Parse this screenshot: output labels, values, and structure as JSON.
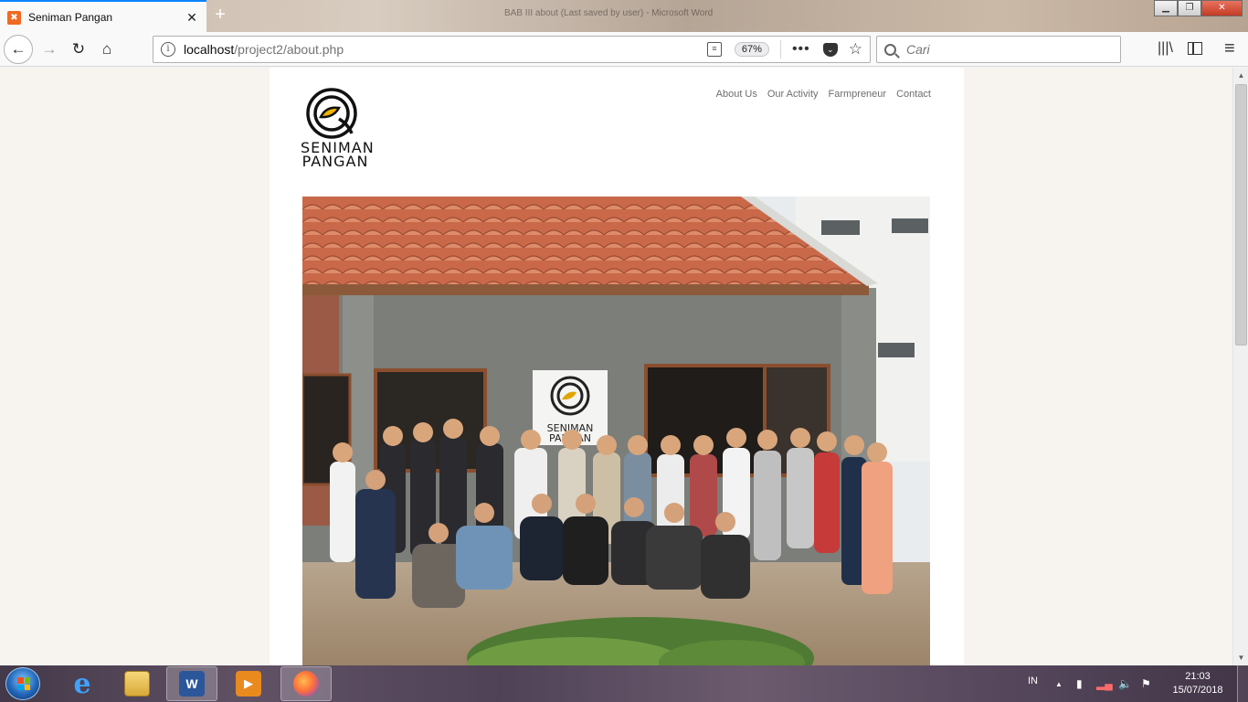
{
  "browser": {
    "tab": {
      "title": "Seniman Pangan",
      "favicon": "xampp-icon",
      "close": "✕"
    },
    "new_tab": "+",
    "window_title_blur": "BAB III about (Last saved by user) - Microsoft Word",
    "window_controls": {
      "minimize": "▁",
      "maximize": "❐",
      "close": "✕"
    },
    "nav": {
      "back": "←",
      "forward": "→",
      "reload": "↻",
      "home": "⌂"
    },
    "url": {
      "host": "localhost",
      "path": "/project2/about.php"
    },
    "zoom": "67%",
    "page_actions": "•••",
    "search": {
      "placeholder": "Cari",
      "value": ""
    },
    "tools": {
      "library": "|||\\",
      "menu": "≡"
    }
  },
  "site": {
    "logo_text_line1": "SENIMAN",
    "logo_text_line2": "PANGAN",
    "nav": [
      {
        "label": "About Us"
      },
      {
        "label": "Our Activity"
      },
      {
        "label": "Farmpreneur"
      },
      {
        "label": "Contact"
      }
    ],
    "hero_alt": "Group photo in front of Seniman Pangan building",
    "sign_line1": "SENIMAN",
    "sign_line2": "PANGAN"
  },
  "taskbar": {
    "items": [
      {
        "name": "internet-explorer",
        "label": "e"
      },
      {
        "name": "file-explorer",
        "label": ""
      },
      {
        "name": "microsoft-word",
        "label": "W"
      },
      {
        "name": "media-player",
        "label": "▶"
      },
      {
        "name": "firefox",
        "label": ""
      }
    ],
    "tray": {
      "language": "IN",
      "time": "21:03",
      "date": "15/07/2018"
    }
  },
  "colors": {
    "accent": "#0a84ff",
    "favicon": "#f16a22",
    "logo_yolk": "#f0b400"
  }
}
